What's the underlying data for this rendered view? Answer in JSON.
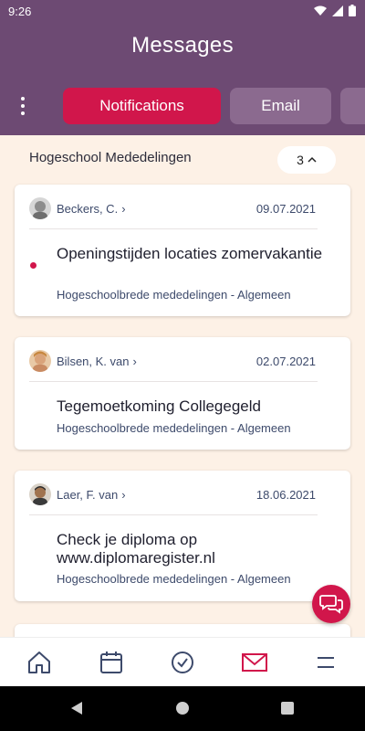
{
  "status": {
    "time": "9:26"
  },
  "header": {
    "title": "Messages"
  },
  "tabs": [
    {
      "label": "Notifications",
      "active": true
    },
    {
      "label": "Email",
      "active": false
    },
    {
      "label": "",
      "active": false
    }
  ],
  "section": {
    "title": "Hogeschool Mededelingen",
    "count": "3"
  },
  "messages": [
    {
      "sender": "Beckers, C.",
      "date": "09.07.2021",
      "title": "Openingstijden locaties zomervakantie",
      "subtitle": "Hogeschoolbrede mededelingen - Algemeen",
      "unread": true
    },
    {
      "sender": "Bilsen, K. van",
      "date": "02.07.2021",
      "title": "Tegemoetkoming Collegegeld",
      "subtitle": "Hogeschoolbrede mededelingen - Algemeen",
      "unread": false
    },
    {
      "sender": "Laer, F. van",
      "date": "18.06.2021",
      "title": "Check je diploma op www.diplomaregister.nl",
      "subtitle": "Hogeschoolbrede mededelingen - Algemeen",
      "unread": false
    }
  ],
  "bottom_nav": [
    "home-icon",
    "calendar-icon",
    "check-circle-icon",
    "mail-icon",
    "menu-icon"
  ],
  "colors": {
    "header": "#6d4a73",
    "accent": "#d1164b",
    "background": "#fdf1e6",
    "text": "#3d4a6b"
  }
}
